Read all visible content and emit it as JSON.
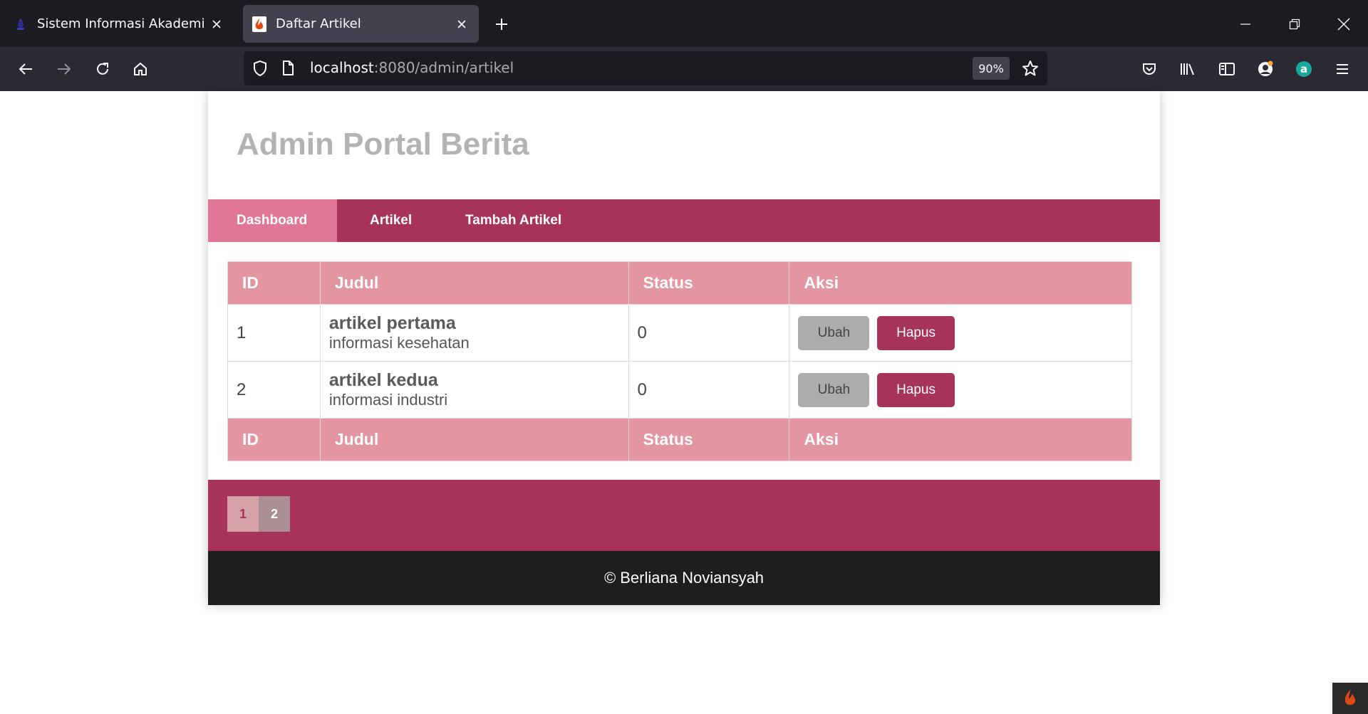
{
  "browser": {
    "tabs": [
      {
        "title": "Sistem Informasi Akademik",
        "active": false,
        "favicon": "academic-logo-icon"
      },
      {
        "title": "Daftar Artikel",
        "active": true,
        "favicon": "codeigniter-flame-icon"
      }
    ],
    "url_host": "localhost",
    "url_path": ":8080/admin/artikel",
    "zoom": "90%"
  },
  "page": {
    "site_title": "Admin Portal Berita",
    "menu": [
      {
        "label": "Dashboard",
        "active": true
      },
      {
        "label": "Artikel",
        "active": false
      },
      {
        "label": "Tambah Artikel",
        "active": false
      }
    ],
    "table": {
      "headers": [
        "ID",
        "Judul",
        "Status",
        "Aksi"
      ],
      "rows": [
        {
          "id": "1",
          "title": "artikel pertama",
          "desc": "informasi kesehatan",
          "status": "0",
          "edit": "Ubah",
          "delete": "Hapus"
        },
        {
          "id": "2",
          "title": "artikel kedua",
          "desc": "informasi industri",
          "status": "0",
          "edit": "Ubah",
          "delete": "Hapus"
        }
      ],
      "footer_headers": [
        "ID",
        "Judul",
        "Status",
        "Aksi"
      ]
    },
    "pagination": [
      "1",
      "2"
    ],
    "footer": "© Berliana Noviansyah"
  },
  "colors": {
    "accent": "#a8335a",
    "menu_active": "#e07797",
    "table_header": "#e395a1",
    "footer_bg": "#1e1e1e"
  }
}
